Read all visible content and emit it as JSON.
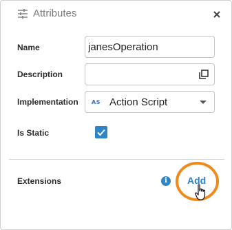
{
  "header": {
    "icon": "tune-icon",
    "title": "Attributes",
    "close_icon": "close-icon"
  },
  "form": {
    "name": {
      "label": "Name",
      "value": "janesOperation"
    },
    "description": {
      "label": "Description",
      "value": "",
      "icon": "open-in-new-icon"
    },
    "implementation": {
      "label": "Implementation",
      "badge": "AS",
      "value": "Action Script",
      "icon": "chevron-down-icon"
    },
    "is_static": {
      "label": "Is Static",
      "checked": true
    }
  },
  "extensions": {
    "label": "Extensions",
    "info_icon": "i",
    "add_label": "Add",
    "highlight_color": "#f08a1d"
  },
  "colors": {
    "accent": "#2f84c6",
    "highlight": "#f08a1d"
  }
}
